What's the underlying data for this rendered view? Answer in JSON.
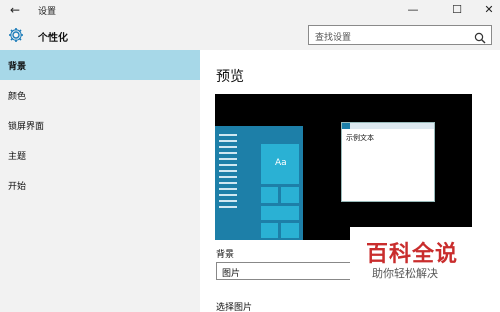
{
  "window": {
    "title": "设置",
    "back_glyph": "←",
    "min_glyph": "—",
    "max_glyph": "☐",
    "close_glyph": "✕"
  },
  "header": {
    "title": "个性化",
    "icon": "gear-icon",
    "search_placeholder": "查找设置",
    "search_icon": "search-icon"
  },
  "sidebar": {
    "items": [
      {
        "label": "背景",
        "active": true
      },
      {
        "label": "颜色",
        "active": false
      },
      {
        "label": "锁屏界面",
        "active": false
      },
      {
        "label": "主题",
        "active": false
      },
      {
        "label": "开始",
        "active": false
      }
    ]
  },
  "main": {
    "section_title": "预览",
    "preview": {
      "tile_label": "Aa",
      "window_text": "示例文本"
    },
    "background_label": "背景",
    "background_value": "图片",
    "choose_label": "选择图片"
  },
  "watermark": {
    "title": "百科全说",
    "subtitle": "助你轻松解决"
  },
  "colors": {
    "accent": "#1d7fa8",
    "sidebar_active": "#a7d8e8",
    "chrome": "#f2f2f2",
    "watermark_red": "#c92d2d"
  }
}
